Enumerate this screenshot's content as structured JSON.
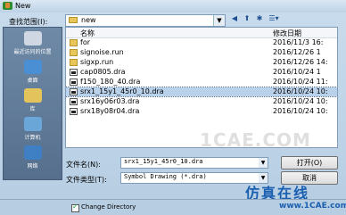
{
  "window": {
    "title": "New"
  },
  "lookin": {
    "label": "查找范围(I):",
    "value": "new"
  },
  "toolbar": {
    "back": "◀",
    "up": "⬆",
    "newfolder": "✱",
    "views": "☰▾"
  },
  "places": [
    {
      "label": "最近访问的位置",
      "color": "#cfd8e2",
      "icon": "recent-places-icon"
    },
    {
      "label": "桌面",
      "color": "#4a8fd4",
      "icon": "desktop-icon"
    },
    {
      "label": "库",
      "color": "#e3c45c",
      "icon": "libraries-icon"
    },
    {
      "label": "计算机",
      "color": "#6aa7d8",
      "icon": "computer-icon"
    },
    {
      "label": "网络",
      "color": "#3f7fc4",
      "icon": "network-icon"
    }
  ],
  "columns": {
    "name": "名称",
    "date": "修改日期"
  },
  "files": [
    {
      "name": "for",
      "date": "2016/11/3 16:",
      "type": "folder"
    },
    {
      "name": "signoise.run",
      "date": "2016/12/26 1",
      "type": "folder"
    },
    {
      "name": "sigxp.run",
      "date": "2016/12/26 14:",
      "type": "folder"
    },
    {
      "name": "cap0805.dra",
      "date": "2016/10/24 1",
      "type": "dra"
    },
    {
      "name": "f150_180_40.dra",
      "date": "2016/10/24 11:",
      "type": "dra"
    },
    {
      "name": "srx1_15y1_45r0_10.dra",
      "date": "2016/10/24 10:",
      "type": "dra",
      "selected": true
    },
    {
      "name": "srx16y06r03.dra",
      "date": "2016/10/24 10:",
      "type": "dra"
    },
    {
      "name": "srx18y08r04.dra",
      "date": "2016/10/24 10:",
      "type": "dra"
    }
  ],
  "watermark": "1CAE.COM",
  "filename": {
    "label": "文件名(N):",
    "value": "srx1_15y1_45r0_10.dra"
  },
  "filetype": {
    "label": "文件类型(T):",
    "value": "Symbol Drawing (*.dra)"
  },
  "buttons": {
    "open": "打开(O)",
    "cancel": "取消"
  },
  "change_directory": {
    "label": "Change Directory",
    "checked": true
  },
  "brand": {
    "text": "仿真在线",
    "url": "www.1CAE.com"
  }
}
